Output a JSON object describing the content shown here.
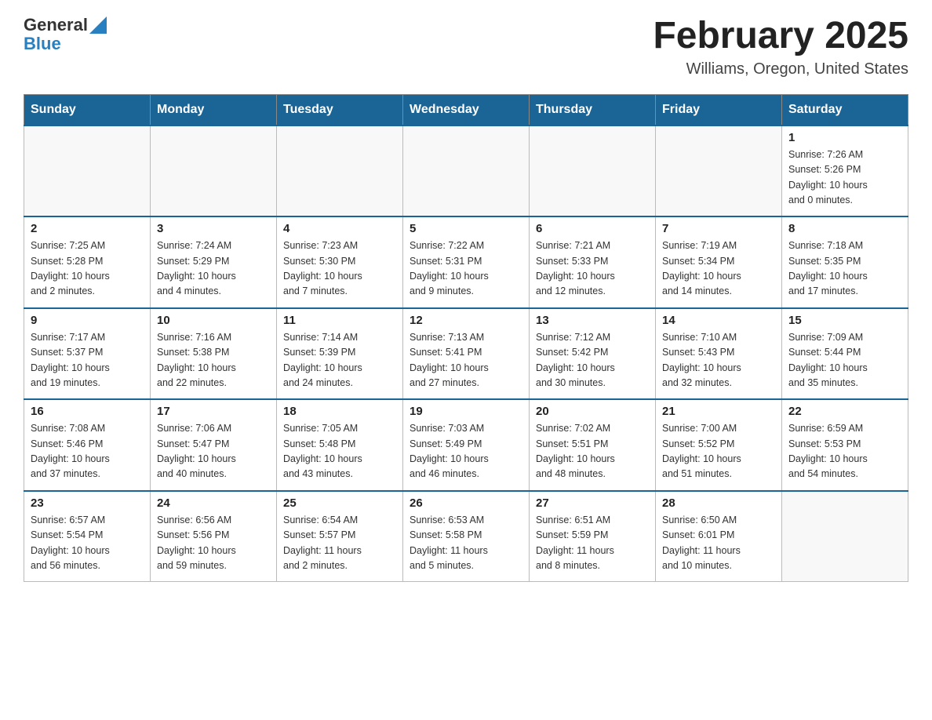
{
  "header": {
    "logo_general": "General",
    "logo_blue": "Blue",
    "month_title": "February 2025",
    "location": "Williams, Oregon, United States"
  },
  "weekdays": [
    "Sunday",
    "Monday",
    "Tuesday",
    "Wednesday",
    "Thursday",
    "Friday",
    "Saturday"
  ],
  "weeks": [
    [
      {
        "day": "",
        "info": ""
      },
      {
        "day": "",
        "info": ""
      },
      {
        "day": "",
        "info": ""
      },
      {
        "day": "",
        "info": ""
      },
      {
        "day": "",
        "info": ""
      },
      {
        "day": "",
        "info": ""
      },
      {
        "day": "1",
        "info": "Sunrise: 7:26 AM\nSunset: 5:26 PM\nDaylight: 10 hours\nand 0 minutes."
      }
    ],
    [
      {
        "day": "2",
        "info": "Sunrise: 7:25 AM\nSunset: 5:28 PM\nDaylight: 10 hours\nand 2 minutes."
      },
      {
        "day": "3",
        "info": "Sunrise: 7:24 AM\nSunset: 5:29 PM\nDaylight: 10 hours\nand 4 minutes."
      },
      {
        "day": "4",
        "info": "Sunrise: 7:23 AM\nSunset: 5:30 PM\nDaylight: 10 hours\nand 7 minutes."
      },
      {
        "day": "5",
        "info": "Sunrise: 7:22 AM\nSunset: 5:31 PM\nDaylight: 10 hours\nand 9 minutes."
      },
      {
        "day": "6",
        "info": "Sunrise: 7:21 AM\nSunset: 5:33 PM\nDaylight: 10 hours\nand 12 minutes."
      },
      {
        "day": "7",
        "info": "Sunrise: 7:19 AM\nSunset: 5:34 PM\nDaylight: 10 hours\nand 14 minutes."
      },
      {
        "day": "8",
        "info": "Sunrise: 7:18 AM\nSunset: 5:35 PM\nDaylight: 10 hours\nand 17 minutes."
      }
    ],
    [
      {
        "day": "9",
        "info": "Sunrise: 7:17 AM\nSunset: 5:37 PM\nDaylight: 10 hours\nand 19 minutes."
      },
      {
        "day": "10",
        "info": "Sunrise: 7:16 AM\nSunset: 5:38 PM\nDaylight: 10 hours\nand 22 minutes."
      },
      {
        "day": "11",
        "info": "Sunrise: 7:14 AM\nSunset: 5:39 PM\nDaylight: 10 hours\nand 24 minutes."
      },
      {
        "day": "12",
        "info": "Sunrise: 7:13 AM\nSunset: 5:41 PM\nDaylight: 10 hours\nand 27 minutes."
      },
      {
        "day": "13",
        "info": "Sunrise: 7:12 AM\nSunset: 5:42 PM\nDaylight: 10 hours\nand 30 minutes."
      },
      {
        "day": "14",
        "info": "Sunrise: 7:10 AM\nSunset: 5:43 PM\nDaylight: 10 hours\nand 32 minutes."
      },
      {
        "day": "15",
        "info": "Sunrise: 7:09 AM\nSunset: 5:44 PM\nDaylight: 10 hours\nand 35 minutes."
      }
    ],
    [
      {
        "day": "16",
        "info": "Sunrise: 7:08 AM\nSunset: 5:46 PM\nDaylight: 10 hours\nand 37 minutes."
      },
      {
        "day": "17",
        "info": "Sunrise: 7:06 AM\nSunset: 5:47 PM\nDaylight: 10 hours\nand 40 minutes."
      },
      {
        "day": "18",
        "info": "Sunrise: 7:05 AM\nSunset: 5:48 PM\nDaylight: 10 hours\nand 43 minutes."
      },
      {
        "day": "19",
        "info": "Sunrise: 7:03 AM\nSunset: 5:49 PM\nDaylight: 10 hours\nand 46 minutes."
      },
      {
        "day": "20",
        "info": "Sunrise: 7:02 AM\nSunset: 5:51 PM\nDaylight: 10 hours\nand 48 minutes."
      },
      {
        "day": "21",
        "info": "Sunrise: 7:00 AM\nSunset: 5:52 PM\nDaylight: 10 hours\nand 51 minutes."
      },
      {
        "day": "22",
        "info": "Sunrise: 6:59 AM\nSunset: 5:53 PM\nDaylight: 10 hours\nand 54 minutes."
      }
    ],
    [
      {
        "day": "23",
        "info": "Sunrise: 6:57 AM\nSunset: 5:54 PM\nDaylight: 10 hours\nand 56 minutes."
      },
      {
        "day": "24",
        "info": "Sunrise: 6:56 AM\nSunset: 5:56 PM\nDaylight: 10 hours\nand 59 minutes."
      },
      {
        "day": "25",
        "info": "Sunrise: 6:54 AM\nSunset: 5:57 PM\nDaylight: 11 hours\nand 2 minutes."
      },
      {
        "day": "26",
        "info": "Sunrise: 6:53 AM\nSunset: 5:58 PM\nDaylight: 11 hours\nand 5 minutes."
      },
      {
        "day": "27",
        "info": "Sunrise: 6:51 AM\nSunset: 5:59 PM\nDaylight: 11 hours\nand 8 minutes."
      },
      {
        "day": "28",
        "info": "Sunrise: 6:50 AM\nSunset: 6:01 PM\nDaylight: 11 hours\nand 10 minutes."
      },
      {
        "day": "",
        "info": ""
      }
    ]
  ]
}
